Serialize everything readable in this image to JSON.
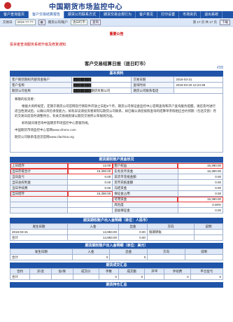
{
  "header": {
    "title": "中国期货市场监控中心"
  },
  "nav": {
    "items": [
      "客户查询首页",
      "客户交易结算报告",
      "期货公司联系方式",
      "期货交易合规行为",
      "客户意见",
      "打印设置",
      "市场资讯",
      "退出系统"
    ],
    "active_index": 1
  },
  "subbar": {
    "label_date": "交易日",
    "date": "2018-??-??",
    "label_type": "期货公司/账户",
    "select": "逐日盯市",
    "btn": "查询",
    "note": "第 17 页 共 17 页",
    "btn2": "下载"
  },
  "notice": {
    "title": "重要公告",
    "link": "投资者查询服务系统升级及修复通知"
  },
  "report": {
    "title": "客户交易结算日报（逐日盯市）",
    "print": "打印"
  },
  "basic": {
    "section": "基本资料",
    "rows": [
      [
        "客户期货期权内部资金账户",
        "████████",
        "交易日期",
        "2018-03-31"
      ],
      [
        "客户名称",
        "████████",
        "查询时间",
        "2018-03-20 12:24:38"
      ],
      [
        "期货公司名称",
        "████████期货有限公司",
        "期货公司联系电话",
        ""
      ]
    ]
  },
  "letter": {
    "greeting": "尊敬的投资者：",
    "p1": "根据大商所规定，定期于期货公司官网及行情软件开放之日起6个月，期货公司保证金监控中心官网查询和开户查询服务提醒，请您及时进行适当性测试后，以确认风险承受能力，如有异议请投资者即刻与期货公司联系，如已确认请您按照查询的结算单参照相应合约到期（包括交割）月的交易日前及时调整持仓，有关交易规则请以期货交易所公布规则为准。",
    "p2": "如有疑问请咨询中国期货市场监控中心客服热线。",
    "p3": "中国期货市场监控中心官网www.cfmmc.com",
    "p4": "期货公司联系电话见官网www.cfachina.org"
  },
  "funds": {
    "section": "期货期权账户资金状况",
    "rows": [
      [
        "上日结存",
        "13.00",
        "客户权益",
        "15,390.00"
      ],
      [
        "当日存取合计",
        "15,390.00",
        "实有货币资金",
        "15,390.00"
      ],
      [
        "当日盈亏",
        "0.00",
        "非货币充抵金额",
        "0.00"
      ],
      [
        "当日总权利金",
        "0.00",
        "货币充抵金额",
        "0.00"
      ],
      [
        "当日手续费",
        "0.00",
        "冻结资金",
        "0.00"
      ],
      [
        "当日结存",
        "15,390.00",
        "保证金占用",
        "0.00"
      ],
      [
        "",
        "",
        "可用资金",
        "15,390.00"
      ],
      [
        "",
        "",
        "风险度",
        "0.00%"
      ],
      [
        "",
        "",
        "追加保证金",
        "0.00"
      ]
    ]
  },
  "inout": {
    "section": "期货期权账户出入金明细（单位：人民币）",
    "headers": [
      "发生日期",
      "入金",
      "出金",
      "方向",
      "说明"
    ],
    "rows": [
      [
        "2018-03-31",
        "14,993.00",
        "0.00",
        "银期转账",
        ""
      ]
    ],
    "total_label": "合计",
    "total": [
      "14,993.00",
      "0.00"
    ]
  },
  "inout_usd": {
    "section": "期货期权账户出入金明细（单位：美元）",
    "headers": [
      "发生日期",
      "入金",
      "出金",
      "方向",
      "说明"
    ],
    "total_label": "合计",
    "total": [
      "0",
      "0"
    ]
  },
  "trade": {
    "section": "期货成交汇总",
    "headers": [
      "合约",
      "买/卖",
      "投/保",
      "成交价",
      "手数",
      "成交额",
      "开平",
      "手续费",
      "平仓盈亏"
    ],
    "total_label": "合计",
    "total": [
      "0",
      "0",
      "0",
      "0"
    ]
  },
  "position": {
    "section": "期货持仓汇总"
  },
  "colors": {
    "nav": "#1f54a8",
    "accent": "#c00",
    "highlight": "#e53935"
  }
}
